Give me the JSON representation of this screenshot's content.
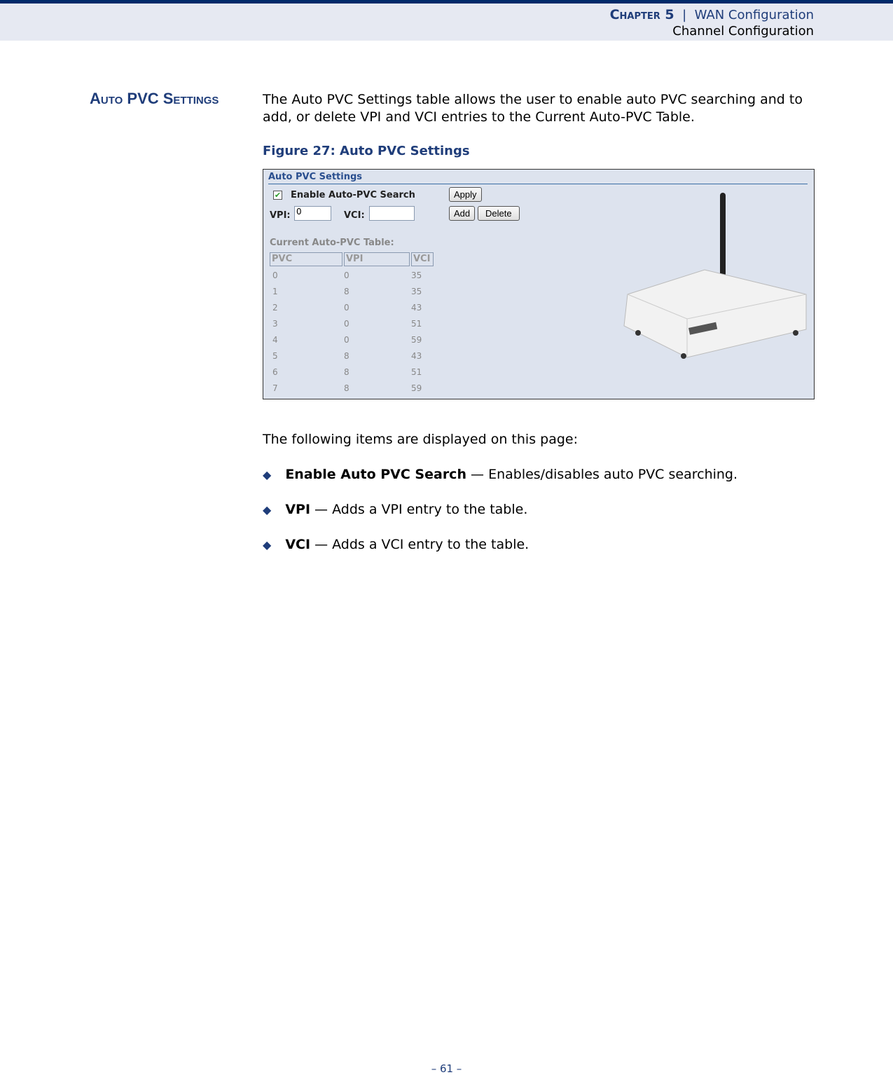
{
  "header": {
    "chapter": "Chapter 5",
    "separator": "|",
    "section": "WAN Configuration",
    "subsection": "Channel Configuration"
  },
  "section_title": "Auto PVC Settings",
  "intro": "The Auto PVC Settings table allows the user to enable auto PVC searching and to add, or delete VPI and VCI entries to the Current Auto-PVC Table.",
  "figure": {
    "caption": "Figure 27:  Auto PVC Settings",
    "panel_title": "Auto PVC Settings",
    "enable_label": "Enable Auto-PVC Search",
    "enable_checked": true,
    "vpi_label": "VPI:",
    "vpi_value": "0",
    "vci_label": "VCI:",
    "vci_value": "",
    "apply": "Apply",
    "add": "Add",
    "delete": "Delete",
    "table_caption": "Current Auto-PVC Table:",
    "columns": [
      "PVC",
      "VPI",
      "VCI"
    ],
    "rows": [
      [
        "0",
        "0",
        "35"
      ],
      [
        "1",
        "8",
        "35"
      ],
      [
        "2",
        "0",
        "43"
      ],
      [
        "3",
        "0",
        "51"
      ],
      [
        "4",
        "0",
        "59"
      ],
      [
        "5",
        "8",
        "43"
      ],
      [
        "6",
        "8",
        "51"
      ],
      [
        "7",
        "8",
        "59"
      ]
    ]
  },
  "items_intro": "The following items are displayed on this page:",
  "items": [
    {
      "term": "Enable Auto PVC Search",
      "desc": " — Enables/disables auto PVC searching."
    },
    {
      "term": "VPI",
      "desc": " — Adds a VPI entry to the table."
    },
    {
      "term": "VCI",
      "desc": " — Adds a VCI entry to the table."
    }
  ],
  "page_number": "–  61  –",
  "colors": {
    "brand": "#1f3d7a",
    "header_bar": "#002a6a"
  }
}
